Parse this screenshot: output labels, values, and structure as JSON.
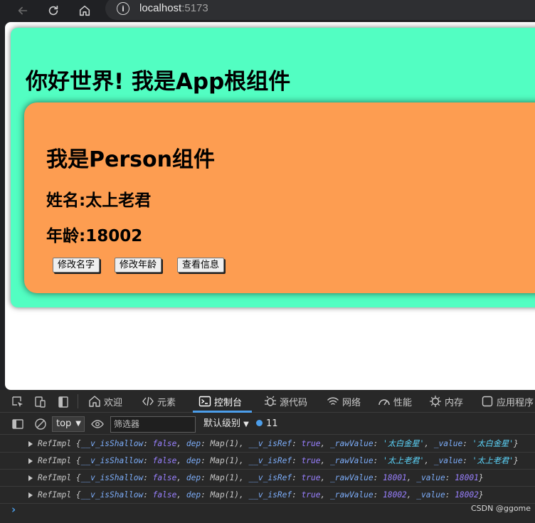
{
  "browser": {
    "url_host": "localhost",
    "url_port": ":5173"
  },
  "app": {
    "title": "你好世界! 我是App根组件",
    "person": {
      "title": "我是Person组件",
      "name_line": "姓名:太上老君",
      "age_line": "年龄:18002",
      "buttons": [
        "修改名字",
        "修改年龄",
        "查看信息"
      ]
    }
  },
  "devtools": {
    "tabs": [
      "欢迎",
      "元素",
      "控制台",
      "源代码",
      "网络",
      "性能",
      "内存",
      "应用程序"
    ],
    "active_tab": "控制台",
    "context": "top",
    "filter_placeholder": "筛选器",
    "level": "默认级别",
    "issues_count": "11",
    "logs": [
      {
        "raw": "'太白金星'",
        "value": "'太白金星'",
        "type": "string"
      },
      {
        "raw": "'太上老君'",
        "value": "'太上老君'",
        "type": "string"
      },
      {
        "raw": "18001",
        "value": "18001",
        "type": "number"
      },
      {
        "raw": "18002",
        "value": "18002",
        "type": "number"
      }
    ],
    "log_parts": {
      "prefix": "RefImpl {",
      "k1": "__v_isShallow",
      "v1": "false",
      "k2": "dep",
      "v2": "Map(1)",
      "k3": "__v_isRef",
      "v3": "true",
      "k4": "_rawValue",
      "k5": "_value",
      "suffix": "}"
    }
  },
  "watermark": "CSDN @ggome",
  "colors": {
    "app_bg": "#52fec2",
    "person_bg": "#fd9d51",
    "devtools_bg": "#282828",
    "accent": "#4c9eea"
  }
}
